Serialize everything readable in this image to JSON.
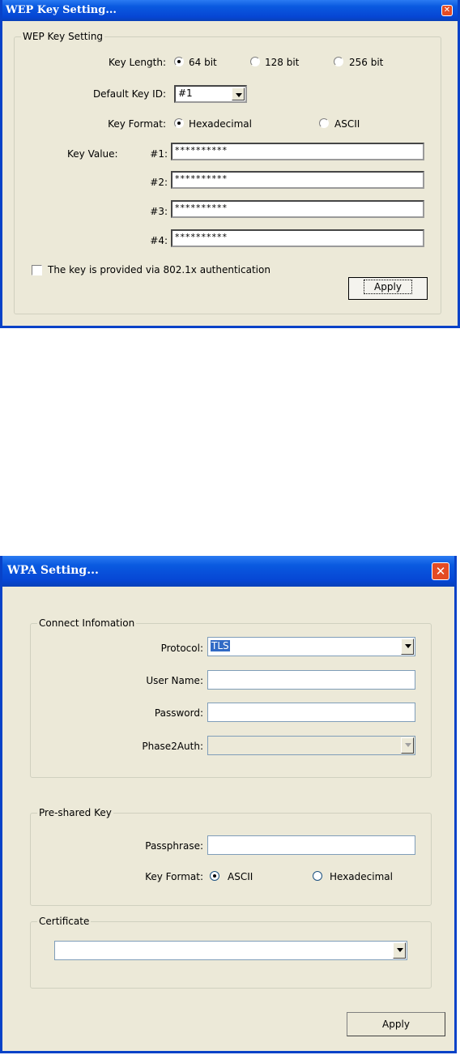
{
  "wep": {
    "title": "WEP Key Setting...",
    "group_label": "WEP Key Setting",
    "key_length_label": "Key Length:",
    "key_length_options": [
      "64 bit",
      "128 bit",
      "256 bit"
    ],
    "key_length_selected": "64 bit",
    "default_key_id_label": "Default Key ID:",
    "default_key_id_value": "#1",
    "key_format_label": "Key Format:",
    "key_format_options": [
      "Hexadecimal",
      "ASCII"
    ],
    "key_format_selected": "Hexadecimal",
    "key_value_label": "Key Value:",
    "keys": [
      {
        "id": "#1:",
        "value": "**********"
      },
      {
        "id": "#2:",
        "value": "**********"
      },
      {
        "id": "#3:",
        "value": "**********"
      },
      {
        "id": "#4:",
        "value": "**********"
      }
    ],
    "checkbox_label": "The key is provided via 802.1x authentication",
    "checkbox_checked": false,
    "apply_label": "Apply"
  },
  "wpa": {
    "title": "WPA Setting...",
    "connect_group_label": "Connect Infomation",
    "protocol_label": "Protocol:",
    "protocol_value": "TLS",
    "username_label": "User Name:",
    "username_value": "",
    "password_label": "Password:",
    "password_value": "",
    "phase2_label": "Phase2Auth:",
    "phase2_value": "",
    "psk_group_label": "Pre-shared Key",
    "passphrase_label": "Passphrase:",
    "passphrase_value": "",
    "key_format_label": "Key Format:",
    "key_format_options": [
      "ASCII",
      "Hexadecimal"
    ],
    "key_format_selected": "ASCII",
    "cert_group_label": "Certificate",
    "cert_value": "",
    "apply_label": "Apply"
  },
  "colors": {
    "titlebar": "#0A5AE0",
    "window_bg": "#ECE9D8",
    "close_button": "#E44B24",
    "selection": "#316AC5"
  }
}
